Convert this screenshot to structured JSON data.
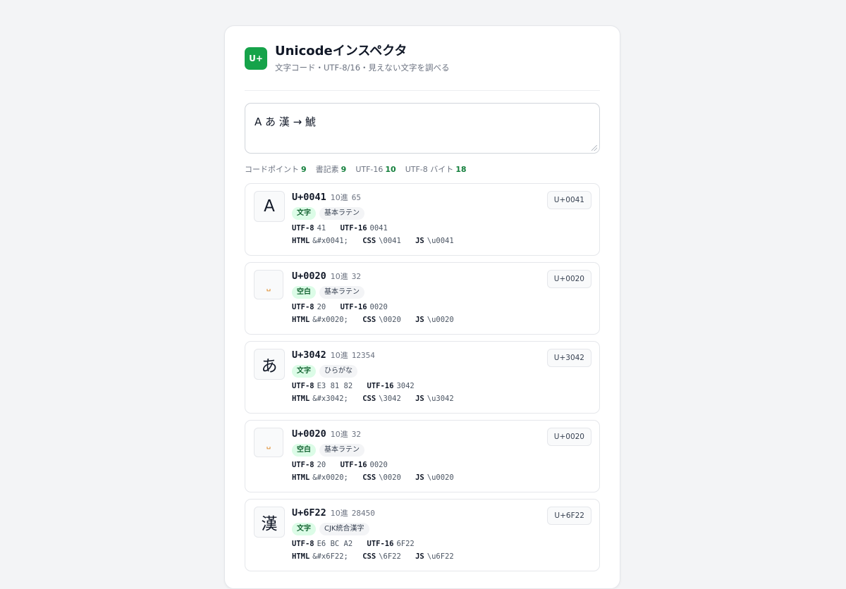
{
  "header": {
    "logo_text": "U+",
    "title": "Unicodeインスペクタ",
    "subtitle": "文字コード・UTF-8/16・見えない文字を調べる"
  },
  "input": {
    "value": "A あ 漢 → 鯱"
  },
  "stats": {
    "codepoints_label": "コードポイント",
    "codepoints": "9",
    "graphemes_label": "書記素",
    "graphemes": "9",
    "utf16_label": "UTF-16",
    "utf16": "10",
    "utf8_label": "UTF-8 バイト",
    "utf8": "18"
  },
  "labels": {
    "decimal": "10進",
    "utf8": "UTF-8",
    "utf16": "UTF-16",
    "html": "HTML",
    "css": "CSS",
    "js": "JS"
  },
  "cards": [
    {
      "glyph": "A",
      "codepoint": "U+0041",
      "decimal": "65",
      "kind": "文字",
      "block": "基本ラテン",
      "utf8": "41",
      "utf16": "0041",
      "html": "&#x0041;",
      "css": "\\0041",
      "js": "\\u0041",
      "copy": "U+0041"
    },
    {
      "glyph": "␣",
      "codepoint": "U+0020",
      "decimal": "32",
      "kind": "空白",
      "block": "基本ラテン",
      "utf8": "20",
      "utf16": "0020",
      "html": "&#x0020;",
      "css": "\\0020",
      "js": "\\u0020",
      "copy": "U+0020"
    },
    {
      "glyph": "あ",
      "codepoint": "U+3042",
      "decimal": "12354",
      "kind": "文字",
      "block": "ひらがな",
      "utf8": "E3 81 82",
      "utf16": "3042",
      "html": "&#x3042;",
      "css": "\\3042",
      "js": "\\u3042",
      "copy": "U+3042"
    },
    {
      "glyph": "␣",
      "codepoint": "U+0020",
      "decimal": "32",
      "kind": "空白",
      "block": "基本ラテン",
      "utf8": "20",
      "utf16": "0020",
      "html": "&#x0020;",
      "css": "\\0020",
      "js": "\\u0020",
      "copy": "U+0020"
    },
    {
      "glyph": "漢",
      "codepoint": "U+6F22",
      "decimal": "28450",
      "kind": "文字",
      "block": "CJK統合漢字",
      "utf8": "E6 BC A2",
      "utf16": "6F22",
      "html": "&#x6F22;",
      "css": "\\6F22",
      "js": "\\u6F22",
      "copy": "U+6F22"
    }
  ]
}
